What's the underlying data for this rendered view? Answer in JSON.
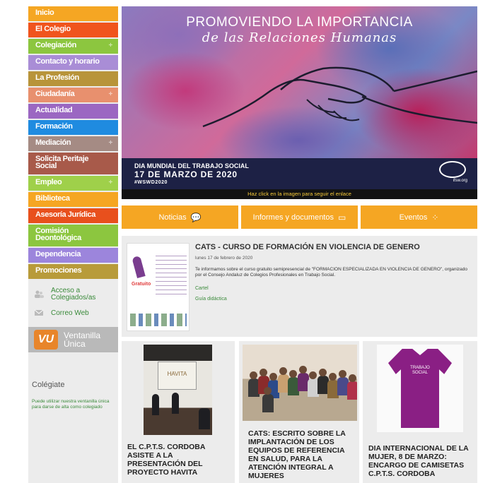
{
  "sidebar": {
    "menu": [
      {
        "label": "Inicio",
        "color": "#f5a623",
        "plus": false
      },
      {
        "label": "El Colegio",
        "color": "#f0541d",
        "plus": false
      },
      {
        "label": "Colegiación",
        "color": "#8cc63f",
        "plus": true
      },
      {
        "label": "Contacto y horario",
        "color": "#a98dd6",
        "plus": false
      },
      {
        "label": "La Profesión",
        "color": "#b8943a",
        "plus": false
      },
      {
        "label": "Ciudadanía",
        "color": "#e8906e",
        "plus": true
      },
      {
        "label": "Actualidad",
        "color": "#9b67c2",
        "plus": false
      },
      {
        "label": "Formación",
        "color": "#1f8be0",
        "plus": false
      },
      {
        "label": "Mediación",
        "color": "#a58b84",
        "plus": true
      },
      {
        "label": "Solicita Peritaje Social",
        "color": "#a85a4a",
        "plus": false,
        "tall": true
      },
      {
        "label": "Empleo",
        "color": "#9fd04a",
        "plus": true
      },
      {
        "label": "Biblioteca",
        "color": "#f5a623",
        "plus": false
      },
      {
        "label": "Asesoría Jurídica",
        "color": "#e8501d",
        "plus": false
      },
      {
        "label": "Comisión Deontológica",
        "color": "#8cc63f",
        "plus": false,
        "tall": true
      },
      {
        "label": "Dependencia",
        "color": "#9c85dc",
        "plus": false
      },
      {
        "label": "Promociones",
        "color": "#b89b3a",
        "plus": false
      }
    ],
    "acceso": "Acceso a Colegiados/as",
    "correo": "Correo Web",
    "ventanilla_logo": "VU",
    "ventanilla": "Ventanilla Única",
    "colegiate_title": "Colégiate",
    "colegiate_text": "Puede utilizar nuestra ventanilla única para darse de alta como colegiado"
  },
  "banner": {
    "title1": "PROMOVIENDO LA IMPORTANCIA",
    "title2": "de las Relaciones Humanas",
    "line1": "DIA MUNDIAL DEL TRABAJO SOCIAL",
    "line2": "17 DE MARZO DE 2020",
    "line3": "#WSWD2020",
    "ifsw": "ifsw.org",
    "click": "Haz click en la imagen para seguir el enlace"
  },
  "tabs": [
    {
      "label": "Noticias",
      "icon": "💬"
    },
    {
      "label": "Informes y documentos",
      "icon": "▭"
    },
    {
      "label": "Eventos",
      "icon": "⁘"
    }
  ],
  "featured": {
    "title": "CATS - CURSO DE FORMACIÓN EN VIOLENCIA DE GENERO",
    "date": "lunes 17 de febrero de 2020",
    "description": "Te informamos sobre el curso gratuito semipresencial de \"FORMACION ESPECIALIZADA EN VIOLENCIA DE GENERO\", organizado por el Consejo Andaluz de Colegios Profesionales en Trabajo Social.",
    "cartel": "Cartel",
    "guia": "Guía didáctica",
    "thumb_badge": "Gratuito"
  },
  "cards": [
    {
      "title": "EL C.P.T.S. CORDOBA ASISTE A LA PRESENTACIÓN DEL PROYECTO HAVITA",
      "screen_text": "HAVITA"
    },
    {
      "title": "CATS: ESCRITO SOBRE LA IMPLANTACIÓN DE LOS EQUIPOS DE REFERENCIA EN SALUD, PARA LA ATENCIÓN INTEGRAL A MUJERES"
    },
    {
      "title": "DIA INTERNACIONAL DE LA MUJER, 8 DE MARZO: ENCARGO DE CAMISETAS C.P.T.S. CORDOBA",
      "shirt_text": "TRABAJO SOCIAL"
    }
  ]
}
